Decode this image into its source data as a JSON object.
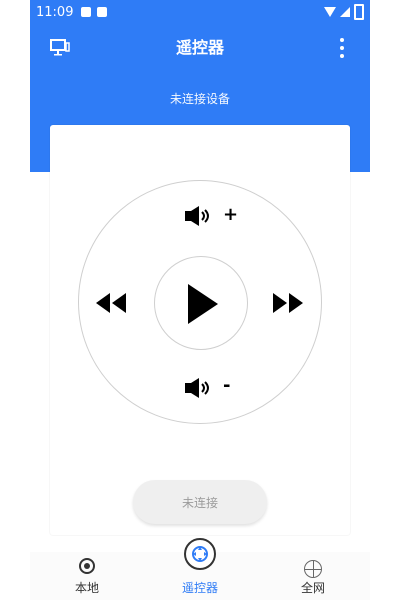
{
  "status_bar": {
    "time": "11:09"
  },
  "header": {
    "title": "遥控器",
    "device_status": "未连接设备"
  },
  "remote": {
    "volume_up_text": "+",
    "volume_down_text": "-"
  },
  "connect_button": {
    "label": "未连接"
  },
  "bottom_nav": {
    "items": [
      {
        "label": "本地"
      },
      {
        "label": "遥控器"
      },
      {
        "label": "全网"
      }
    ]
  },
  "colors": {
    "primary": "#2f7cf6",
    "inactive_text": "#333333"
  }
}
